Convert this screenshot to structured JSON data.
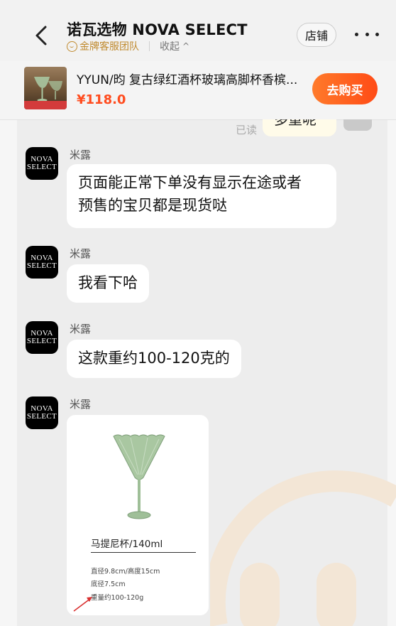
{
  "header": {
    "title": "诺瓦选物 NOVA SELECT",
    "team_label": "金牌客服团队",
    "collapse_label": "收起",
    "store_button": "店铺"
  },
  "product": {
    "name": "YYUN/昀 复古绿红酒杯玻璃高脚杯香槟...",
    "price": "¥118.0",
    "buy_button": "去购买"
  },
  "colors": {
    "accent": "#ff5a1f",
    "gold": "#c08a2e",
    "glass_green": "#a9c7a1"
  },
  "chat": {
    "read_label": "已读",
    "partial_outgoing": "多重呢",
    "messages": [
      {
        "sender": "米露",
        "avatar_text": [
          "NOVA",
          "SELECT"
        ],
        "lines": [
          "页面能正常下单没有显示在途或者",
          "预售的宝贝都是现货哒"
        ]
      },
      {
        "sender": "米露",
        "avatar_text": [
          "NOVA",
          "SELECT"
        ],
        "lines": [
          "我看下哈"
        ]
      },
      {
        "sender": "米露",
        "avatar_text": [
          "NOVA",
          "SELECT"
        ],
        "lines": [
          "这款重约100-120克的"
        ]
      },
      {
        "sender": "米露",
        "avatar_text": [
          "NOVA",
          "SELECT"
        ],
        "image": {
          "title": "马提尼杯/140ml",
          "specs": [
            "直径9.8cm/高度15cm",
            "底径7.5cm",
            "重量约100-120g"
          ]
        }
      }
    ]
  }
}
